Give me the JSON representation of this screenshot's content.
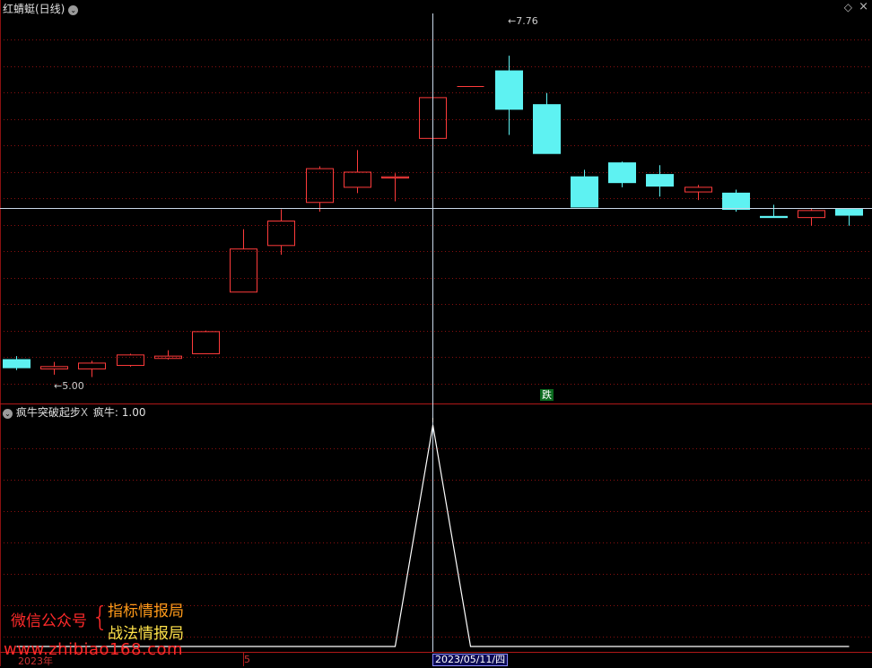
{
  "header": {
    "stock_name": "红蜻蜓(日线)",
    "dropdown_glyph": "⌄",
    "corner_glyph": "◇",
    "close_glyph": "×"
  },
  "indicator": {
    "name": "疯牛突破起步",
    "close_glyph": "X",
    "value_label": "疯牛: 1.00"
  },
  "annotations": {
    "high_price": "7.76",
    "low_price": "5.00",
    "signal_tag": "跌"
  },
  "watermark": {
    "wechat": "微信公众号",
    "brace": "{",
    "line1": "指标情报局",
    "line2": "战法情报局",
    "url": "www.zhibiao168.com"
  },
  "axis": {
    "year_label": "2023年",
    "month_label": "5",
    "cursor_date": "2023/05/11/四"
  },
  "colors": {
    "up": "#ff3b3b",
    "down": "#5ef2f2",
    "grid": "#8a1010",
    "crosshair": "#c8d8e8",
    "indicator_line": "#ffffff",
    "wm_red": "#ff2a2a",
    "wm_orange": "#ff9a1a",
    "wm_yellow": "#ffe24a"
  },
  "chart_data": {
    "type": "candlestick",
    "ylim": [
      4.85,
      8.1
    ],
    "candles": [
      {
        "o": 5.15,
        "c": 5.08,
        "h": 5.18,
        "l": 5.06
      },
      {
        "o": 5.07,
        "c": 5.09,
        "h": 5.13,
        "l": 5.02
      },
      {
        "o": 5.07,
        "c": 5.12,
        "h": 5.14,
        "l": 5.0
      },
      {
        "o": 5.1,
        "c": 5.19,
        "h": 5.2,
        "l": 5.09
      },
      {
        "o": 5.16,
        "c": 5.18,
        "h": 5.23,
        "l": 5.15
      },
      {
        "o": 5.2,
        "c": 5.39,
        "h": 5.4,
        "l": 5.2
      },
      {
        "o": 5.73,
        "c": 6.1,
        "h": 6.27,
        "l": 5.73
      },
      {
        "o": 6.13,
        "c": 6.34,
        "h": 6.44,
        "l": 6.05
      },
      {
        "o": 6.5,
        "c": 6.79,
        "h": 6.81,
        "l": 6.42
      },
      {
        "o": 6.63,
        "c": 6.76,
        "h": 6.95,
        "l": 6.58
      },
      {
        "o": 6.71,
        "c": 6.72,
        "h": 6.75,
        "l": 6.51
      },
      {
        "o": 7.05,
        "c": 7.4,
        "h": 7.4,
        "l": 6.8
      },
      {
        "o": 7.5,
        "c": 7.5,
        "h": 7.5,
        "l": 7.5
      },
      {
        "o": 7.63,
        "c": 7.3,
        "h": 7.76,
        "l": 7.08
      },
      {
        "o": 7.34,
        "c": 6.92,
        "h": 7.44,
        "l": 6.92
      },
      {
        "o": 6.72,
        "c": 6.46,
        "h": 6.78,
        "l": 6.46
      },
      {
        "o": 6.84,
        "c": 6.67,
        "h": 6.85,
        "l": 6.63
      },
      {
        "o": 6.74,
        "c": 6.64,
        "h": 6.82,
        "l": 6.55
      },
      {
        "o": 6.59,
        "c": 6.63,
        "h": 6.65,
        "l": 6.52
      },
      {
        "o": 6.58,
        "c": 6.44,
        "h": 6.61,
        "l": 6.42
      },
      {
        "o": 6.38,
        "c": 6.37,
        "h": 6.48,
        "l": 6.37
      },
      {
        "o": 6.37,
        "c": 6.43,
        "h": 6.45,
        "l": 6.3
      },
      {
        "o": 6.44,
        "c": 6.39,
        "h": 6.44,
        "l": 6.3
      }
    ],
    "indicator": {
      "name": "疯牛",
      "values": [
        0,
        0,
        0,
        0,
        0,
        0,
        0,
        0,
        0,
        0,
        0,
        1,
        0,
        0,
        0,
        0,
        0,
        0,
        0,
        0,
        0,
        0,
        0
      ]
    },
    "cursor_index": 11
  }
}
